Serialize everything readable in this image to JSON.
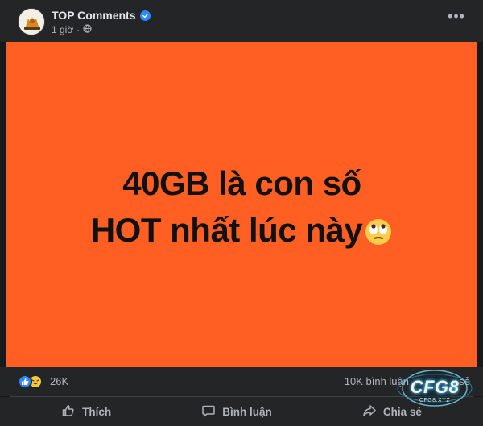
{
  "post": {
    "page_name": "TOP Comments",
    "time": "1 giờ",
    "dot": "·",
    "more": "•••"
  },
  "image": {
    "line1": "40GB là con số",
    "line2": "HOT nhất lúc này",
    "background_color": "#ff5f22",
    "emoji": "face-with-rolling-eyes"
  },
  "stats": {
    "reactions_count": "26K",
    "comments_count": "10K bình luận",
    "shares_partial": "sẻ"
  },
  "actions": {
    "like": "Thích",
    "comment": "Bình luận",
    "share": "Chia sẻ"
  },
  "watermark": {
    "logo_text": "CFG8",
    "tagline": "CFG8.XYZ"
  },
  "colors": {
    "accent_blue": "#2d88ff",
    "card_bg": "#242526",
    "muted_text": "#b0b3b8"
  }
}
